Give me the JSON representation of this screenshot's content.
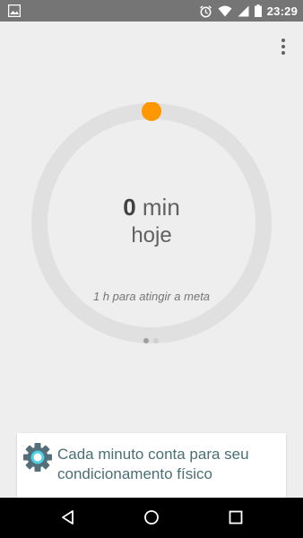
{
  "status_bar": {
    "time": "23:29",
    "icons": [
      "image-icon",
      "alarm-icon",
      "wifi-icon",
      "signal-icon",
      "battery-icon"
    ]
  },
  "toolbar": {
    "menu_icon": "overflow-menu-icon"
  },
  "summary": {
    "minutes_value": "0",
    "minutes_unit": "min",
    "period_label": "hoje",
    "goal_text": "1 h para atingir a meta",
    "progress_fraction": 0,
    "page_count": 2,
    "active_page": 1
  },
  "card": {
    "icon": "gear-icon",
    "text": "Cada minuto conta para seu condicionamento físico"
  },
  "colors": {
    "status_bar_bg": "#757575",
    "background": "#eeeeee",
    "ring_track": "#e0e0e0",
    "progress_accent": "#ff9800",
    "card_text": "#4a6f73",
    "gear_accent": "#4dd0e1",
    "nav_bar_bg": "#000000"
  },
  "nav_bar": {
    "icons": [
      "back-icon",
      "home-icon",
      "recents-icon"
    ]
  }
}
